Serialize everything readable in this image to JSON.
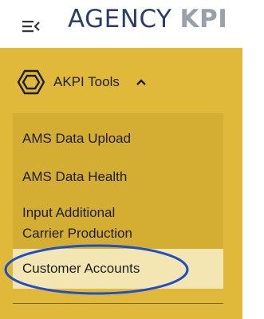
{
  "header": {
    "logo_agency": "AGENCY",
    "logo_kpi": "KPI",
    "menu_icon": "menu-collapse-icon",
    "logo_colors": {
      "agency": "#2b3f6a",
      "kpi": "#9aa0a8"
    }
  },
  "sidebar": {
    "background_color": "#e0b93a",
    "section": {
      "label": "AKPI Tools",
      "icon": "hexagon-nut-icon",
      "expanded": true,
      "chevron_icon": "chevron-up-icon"
    },
    "items": [
      {
        "label": "AMS Data Upload",
        "active": false
      },
      {
        "label": "AMS Data Health",
        "active": false
      },
      {
        "label": "Input Additional Carrier Production",
        "line1": "Input Additional",
        "line2": "Carrier Production",
        "active": false
      },
      {
        "label": "Customer Accounts",
        "active": true
      }
    ],
    "active_item_color": "#f4e6b2"
  },
  "annotation": {
    "shape": "ellipse",
    "color": "#1f4fc8",
    "target": "Customer Accounts"
  }
}
